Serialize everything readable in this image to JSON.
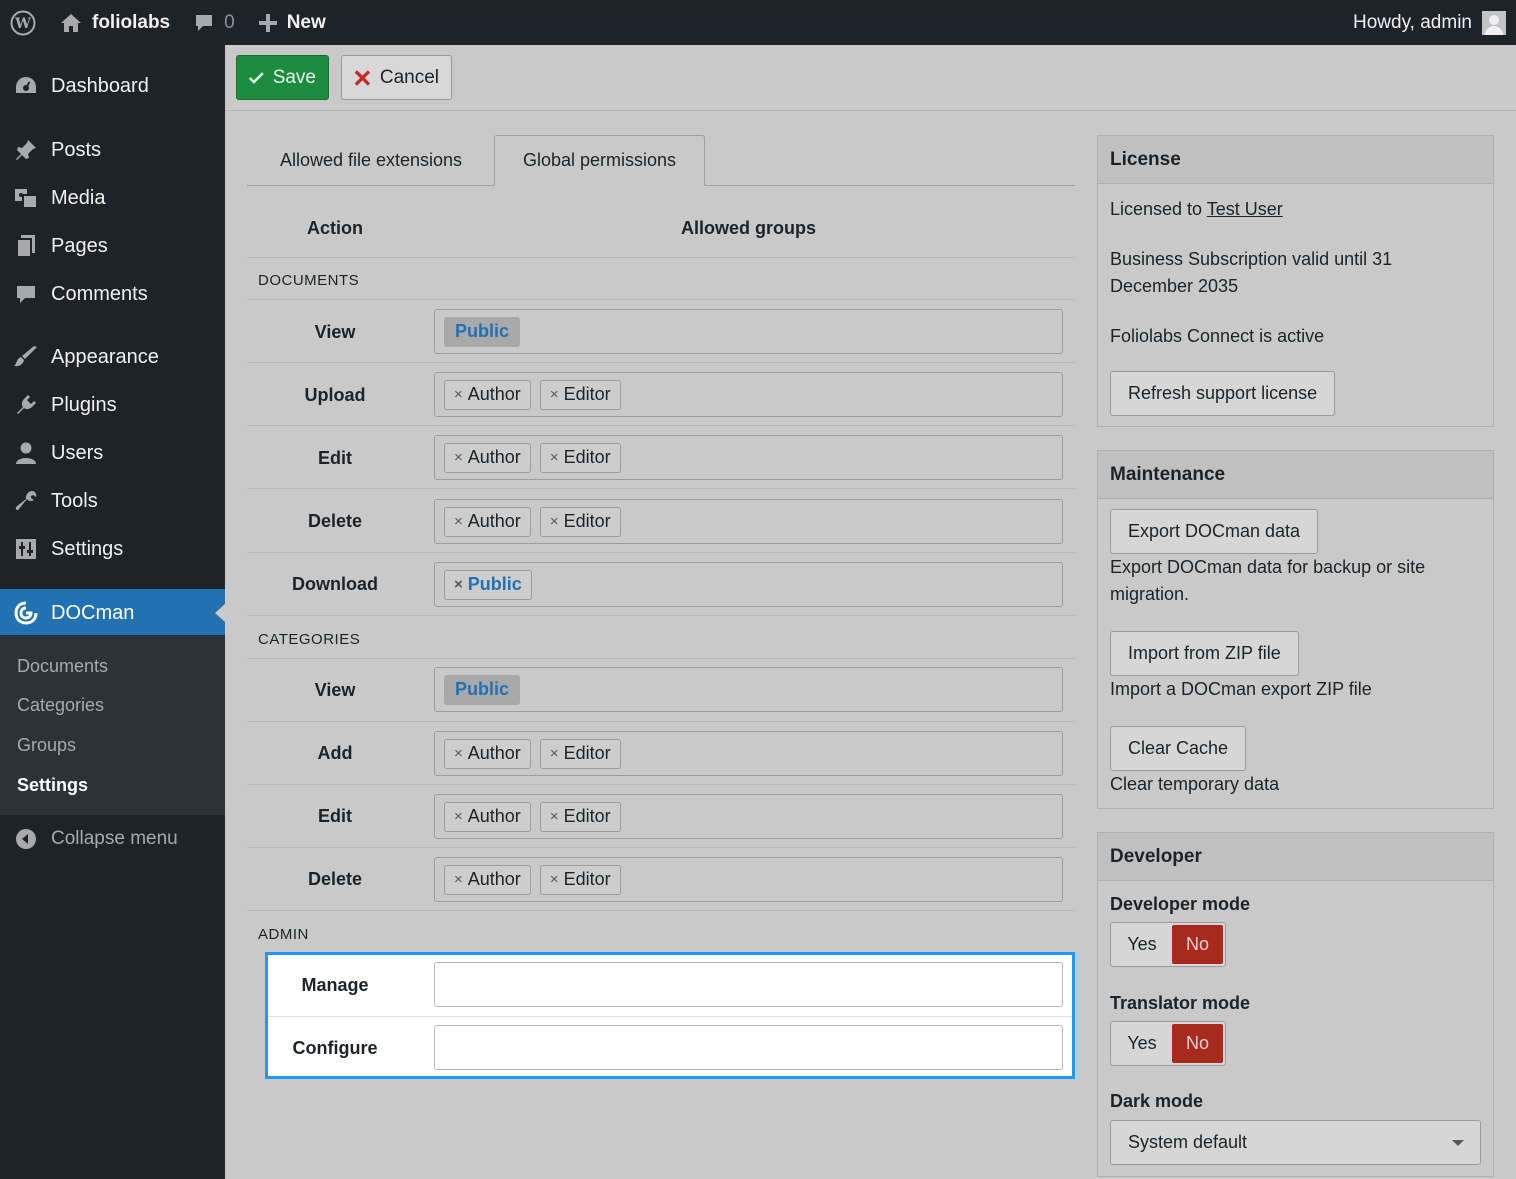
{
  "admin_bar": {
    "site_name": "foliolabs",
    "comment_count": "0",
    "new_label": "New",
    "greeting": "Howdy, admin"
  },
  "sidebar": {
    "items": [
      {
        "label": "Dashboard",
        "icon": "dashboard-icon"
      },
      {
        "label": "Posts",
        "icon": "pin-icon"
      },
      {
        "label": "Media",
        "icon": "media-icon"
      },
      {
        "label": "Pages",
        "icon": "pages-icon"
      },
      {
        "label": "Comments",
        "icon": "comment-icon"
      },
      {
        "label": "Appearance",
        "icon": "brush-icon"
      },
      {
        "label": "Plugins",
        "icon": "plug-icon"
      },
      {
        "label": "Users",
        "icon": "user-icon"
      },
      {
        "label": "Tools",
        "icon": "wrench-icon"
      },
      {
        "label": "Settings",
        "icon": "settings-icon"
      },
      {
        "label": "DOCman",
        "icon": "docman-icon"
      }
    ],
    "submenu": [
      "Documents",
      "Categories",
      "Groups",
      "Settings"
    ],
    "collapse_label": "Collapse menu"
  },
  "toolbar": {
    "save_label": "Save",
    "cancel_label": "Cancel"
  },
  "tabs": [
    "Allowed file extensions",
    "Global permissions"
  ],
  "permissions": {
    "header_action": "Action",
    "header_groups": "Allowed groups",
    "sections": {
      "documents": "DOCUMENTS",
      "categories": "CATEGORIES",
      "admin": "ADMIN"
    },
    "actions": {
      "doc_view": "View",
      "doc_upload": "Upload",
      "doc_edit": "Edit",
      "doc_delete": "Delete",
      "doc_download": "Download",
      "cat_view": "View",
      "cat_add": "Add",
      "cat_edit": "Edit",
      "cat_delete": "Delete",
      "admin_manage": "Manage",
      "admin_configure": "Configure"
    },
    "groups": {
      "public": "Public",
      "author": "Author",
      "editor": "Editor",
      "remove": "×"
    }
  },
  "license": {
    "title": "License",
    "licensed_prefix": "Licensed to",
    "licensed_user": "Test User",
    "subscription": "Business Subscription valid until 31 December 2035",
    "connect_status": "Foliolabs Connect is active",
    "refresh_button": "Refresh support license"
  },
  "maintenance": {
    "title": "Maintenance",
    "export_button": "Export DOCman data",
    "export_desc": "Export DOCman data for backup or site migration.",
    "import_button": "Import from ZIP file",
    "import_desc": "Import a DOCman export ZIP file",
    "clear_button": "Clear Cache",
    "clear_desc": "Clear temporary data"
  },
  "developer": {
    "title": "Developer",
    "developer_mode_label": "Developer mode",
    "translator_mode_label": "Translator mode",
    "dark_mode_label": "Dark mode",
    "yes": "Yes",
    "no": "No",
    "dark_mode_value": "System default"
  },
  "colors": {
    "accent": "#2271b1",
    "save": "#1e8c3e",
    "toggle_no": "#a8291e",
    "highlight": "#2196f3"
  }
}
